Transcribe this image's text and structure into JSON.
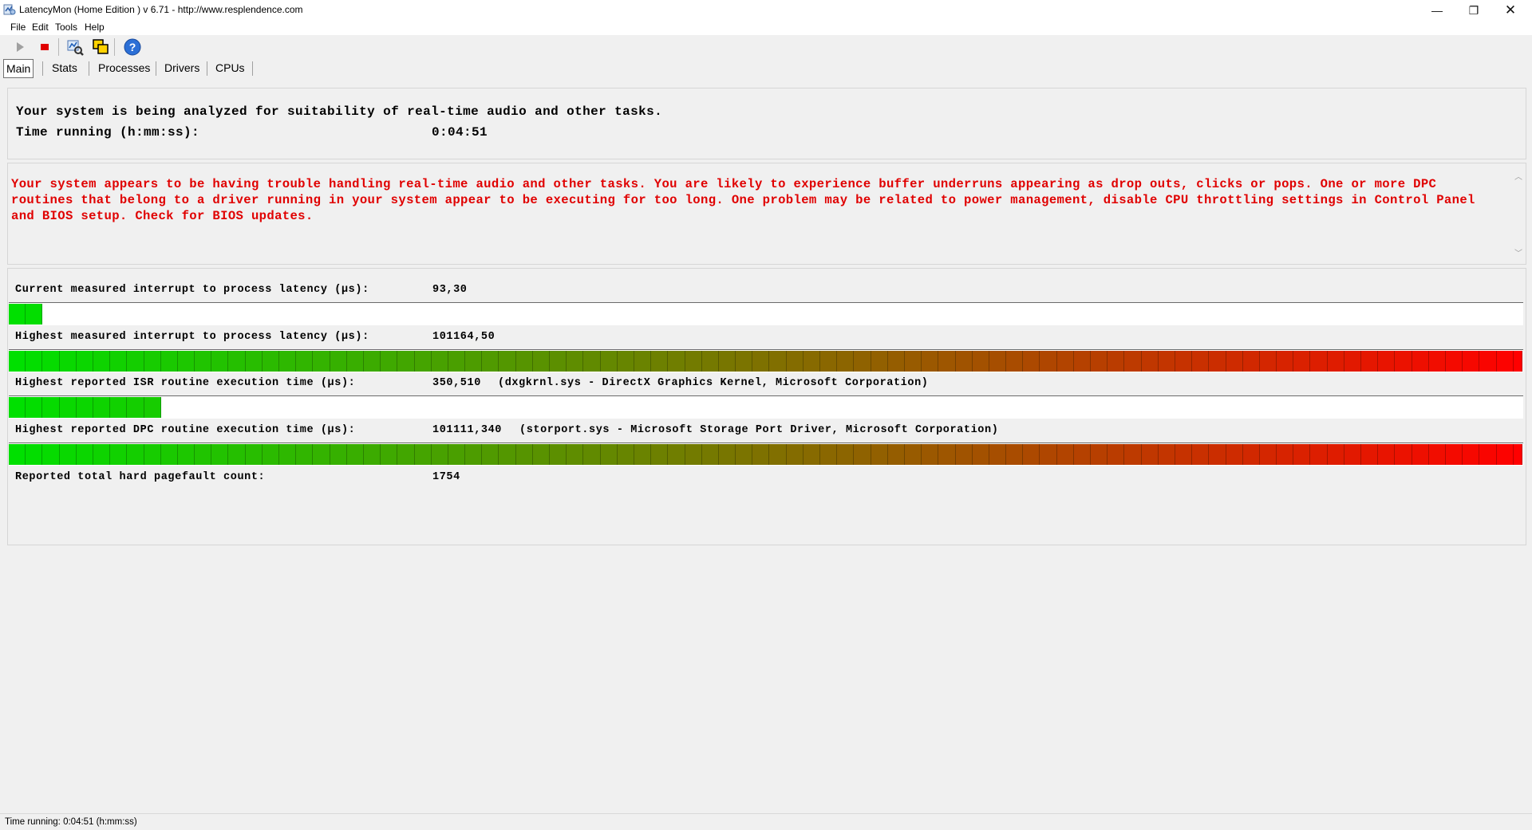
{
  "window": {
    "title": "LatencyMon  (Home Edition )  v 6.71 - http://www.resplendence.com",
    "minimize_label": "—",
    "maximize_label": "❐",
    "close_label": "✕"
  },
  "menu": [
    "File",
    "Edit",
    "Tools",
    "Help"
  ],
  "toolbar": {
    "icons": [
      "play-icon",
      "stop-icon",
      "analyze-icon",
      "windows-icon",
      "help-icon"
    ]
  },
  "tabs": [
    "Main",
    "Stats",
    "Processes",
    "Drivers",
    "CPUs"
  ],
  "status": {
    "analyzing": "Your system is being analyzed for suitability of real-time audio and other tasks.",
    "time_label": "Time running (h:mm:ss):",
    "time_value": "0:04:51"
  },
  "warning": "Your system appears to be having trouble handling real-time audio and other tasks. You are likely to experience buffer underruns appearing as drop outs, clicks or pops. One or more DPC routines that belong to a driver running in your system appear to be executing for too long. One problem may be related to power management, disable CPU throttling settings in Control Panel and BIOS setup. Check for BIOS updates.",
  "metrics": [
    {
      "label": "Current measured interrupt to process latency (µs):",
      "value": "93,30",
      "detail": "",
      "level": 0.022
    },
    {
      "label": "Highest measured interrupt to process latency (µs):",
      "value": "101164,50",
      "detail": "",
      "level": 1.0
    },
    {
      "label": "Highest reported ISR routine execution time (µs):",
      "value": "350,510",
      "detail": "(dxgkrnl.sys - DirectX Graphics Kernel, Microsoft Corporation)",
      "level": 0.105
    },
    {
      "label": "Highest reported DPC routine execution time (µs):",
      "value": "101111,340",
      "detail": "(storport.sys - Microsoft Storage Port Driver, Microsoft Corporation)",
      "level": 1.0
    }
  ],
  "pagefault": {
    "label": "Reported total hard pagefault count:",
    "value": "1754"
  },
  "statusbar": "Time running: 0:04:51  (h:mm:ss)",
  "colors": {
    "meter_start": "#00e000",
    "meter_end": "#ff0000",
    "warning": "#e00000"
  }
}
